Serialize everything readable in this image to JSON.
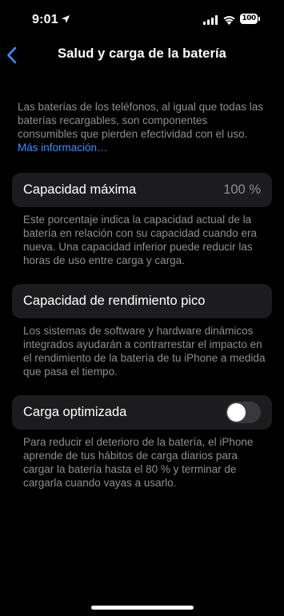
{
  "status_bar": {
    "time": "9:01",
    "battery_percent": "100",
    "icons": [
      "location-icon",
      "signal-icon",
      "wifi-icon",
      "battery-icon"
    ]
  },
  "nav": {
    "back_icon": "chevron-left-icon",
    "title": "Salud y carga de la batería"
  },
  "intro": {
    "text": "Las baterías de los teléfonos, al igual que todas las baterías recargables, son componentes consumibles que pierden efectividad con el uso.",
    "link": "Más información…"
  },
  "max_capacity": {
    "label": "Capacidad máxima",
    "value": "100 %",
    "footnote": "Este porcentaje indica la capacidad actual de la batería en relación con su capacidad cuando era nueva. Una capacidad inferior puede reducir las horas de uso entre carga y carga."
  },
  "peak_performance": {
    "label": "Capacidad de rendimiento pico",
    "footnote": "Los sistemas de software y hardware dinámicos integrados ayudarán a contrarrestar el impacto en el rendimiento de la batería de tu iPhone a medida que pasa el tiempo."
  },
  "optimized_charging": {
    "label": "Carga optimizada",
    "enabled": false,
    "footnote": "Para reducir el deterioro de la batería, el iPhone aprende de tus hábitos de carga diarios para cargar la batería hasta el 80 % y terminar de cargarla cuando vayas a usarlo."
  },
  "colors": {
    "background": "#000000",
    "card": "#1c1c1e",
    "secondary_text": "#8e8e93",
    "link": "#3e8dff",
    "toggle_off": "#39393d"
  }
}
